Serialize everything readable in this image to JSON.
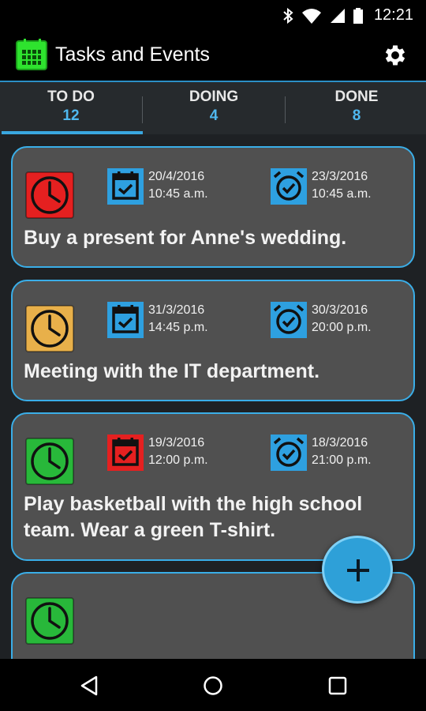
{
  "statusbar": {
    "time": "12:21"
  },
  "app": {
    "title": "Tasks and Events"
  },
  "tabs": [
    {
      "label": "TO DO",
      "count": "12"
    },
    {
      "label": "DOING",
      "count": "4"
    },
    {
      "label": "DONE",
      "count": "8"
    }
  ],
  "tasks": [
    {
      "title": "Buy a present for Anne's wedding.",
      "status_color": "#e52020",
      "due_date": "20/4/2016",
      "due_time": "10:45 a.m.",
      "due_icon_color": "#2ea0e0",
      "alarm_date": "23/3/2016",
      "alarm_time": "10:45 a.m.",
      "alarm_icon_color": "#2ea0e0"
    },
    {
      "title": "Meeting with the IT department.",
      "status_color": "#e8b04a",
      "due_date": "31/3/2016",
      "due_time": "14:45 p.m.",
      "due_icon_color": "#2ea0e0",
      "alarm_date": "30/3/2016",
      "alarm_time": "20:00 p.m.",
      "alarm_icon_color": "#2ea0e0"
    },
    {
      "title_line1": "Play basketball with the high school",
      "title_line2": "team. Wear a green T-shirt.",
      "status_color": "#28b83a",
      "due_date": "19/3/2016",
      "due_time": "12:00 p.m.",
      "due_icon_color": "#e52020",
      "alarm_date": "18/3/2016",
      "alarm_time": "21:00 p.m.",
      "alarm_icon_color": "#2ea0e0"
    },
    {
      "status_color": "#28b83a"
    }
  ],
  "icons": {
    "status": "clock-icon",
    "due": "calendar-check-icon",
    "alarm": "alarm-clock-icon",
    "settings": "gear-icon",
    "add": "plus-icon",
    "nav": [
      "back-icon",
      "home-icon",
      "recents-icon"
    ]
  },
  "colors": {
    "accent": "#3aa7e0",
    "card_bg": "#505050",
    "tab_bg": "#262a2d"
  }
}
